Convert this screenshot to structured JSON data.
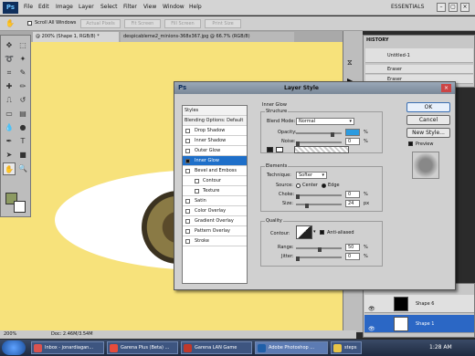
{
  "menubar": {
    "items": [
      "File",
      "Edit",
      "Image",
      "Layer",
      "Select",
      "Filter",
      "View",
      "Window",
      "Help"
    ],
    "workspace": "ESSENTIALS",
    "window_controls": [
      "–",
      "▢",
      "×"
    ]
  },
  "options": {
    "scroll_all_label": "Scroll All Windows",
    "buttons": [
      "Actual Pixels",
      "Fit Screen",
      "Fill Screen",
      "Print Size"
    ]
  },
  "document": {
    "tabs": [
      "@ 200% (Shape 1, RGB/8) *",
      "despicableme2_minions-368x367.jpg @ 66.7% (RGB/8)"
    ],
    "zoom": "200%",
    "doc_info": "Doc: 2.46M/3.54M"
  },
  "history": {
    "title": "HISTORY",
    "snapshot": "Untitled-1",
    "rows": [
      "Eraser",
      "Eraser"
    ]
  },
  "layers": {
    "rows": [
      {
        "name": "Shape 6",
        "selected": false
      },
      {
        "name": "Shape 1",
        "selected": true
      }
    ]
  },
  "dialog": {
    "title": "Layer Style",
    "styles_header": "Styles",
    "blending": "Blending Options: Default",
    "styles": [
      {
        "label": "Drop Shadow",
        "checked": false,
        "sub": false,
        "active": false
      },
      {
        "label": "Inner Shadow",
        "checked": false,
        "sub": false,
        "active": false
      },
      {
        "label": "Outer Glow",
        "checked": false,
        "sub": false,
        "active": false
      },
      {
        "label": "Inner Glow",
        "checked": true,
        "sub": false,
        "active": true
      },
      {
        "label": "Bevel and Emboss",
        "checked": false,
        "sub": false,
        "active": false
      },
      {
        "label": "Contour",
        "checked": false,
        "sub": true,
        "active": false
      },
      {
        "label": "Texture",
        "checked": false,
        "sub": true,
        "active": false
      },
      {
        "label": "Satin",
        "checked": false,
        "sub": false,
        "active": false
      },
      {
        "label": "Color Overlay",
        "checked": false,
        "sub": false,
        "active": false
      },
      {
        "label": "Gradient Overlay",
        "checked": false,
        "sub": false,
        "active": false
      },
      {
        "label": "Pattern Overlay",
        "checked": false,
        "sub": false,
        "active": false
      },
      {
        "label": "Stroke",
        "checked": false,
        "sub": false,
        "active": false
      }
    ],
    "section_title": "Inner Glow",
    "structure": {
      "title": "Structure",
      "blend_mode_label": "Blend Mode:",
      "blend_mode_value": "Normal",
      "opacity_label": "Opacity:",
      "opacity_value": "",
      "noise_label": "Noise:",
      "noise_value": "0",
      "percent": "%"
    },
    "elements": {
      "title": "Elements",
      "technique_label": "Technique:",
      "technique_value": "Softer",
      "source_label": "Source:",
      "center_label": "Center",
      "edge_label": "Edge",
      "choke_label": "Choke:",
      "choke_value": "0",
      "size_label": "Size:",
      "size_value": "24",
      "px": "px",
      "percent": "%"
    },
    "quality": {
      "title": "Quality",
      "contour_label": "Contour:",
      "antialiased_label": "Anti-aliased",
      "range_label": "Range:",
      "range_value": "50",
      "jitter_label": "Jitter:",
      "jitter_value": "0",
      "percent": "%"
    },
    "buttons": {
      "ok": "OK",
      "cancel": "Cancel",
      "new_style": "New Style...",
      "preview": "Preview"
    }
  },
  "taskbar": {
    "items": [
      {
        "label": "Inbox - jonardiagan...",
        "color": "#d9534f",
        "active": false
      },
      {
        "label": "Garena Plus (Beta) ...",
        "color": "#e74c3c",
        "active": false
      },
      {
        "label": "Garena LAN Game",
        "color": "#c0392b",
        "active": false
      },
      {
        "label": "Adobe Photoshop ...",
        "color": "#1f5fa8",
        "active": true
      },
      {
        "label": "steps",
        "color": "#e8c547",
        "active": false
      }
    ],
    "clock": "1:28 AM"
  }
}
